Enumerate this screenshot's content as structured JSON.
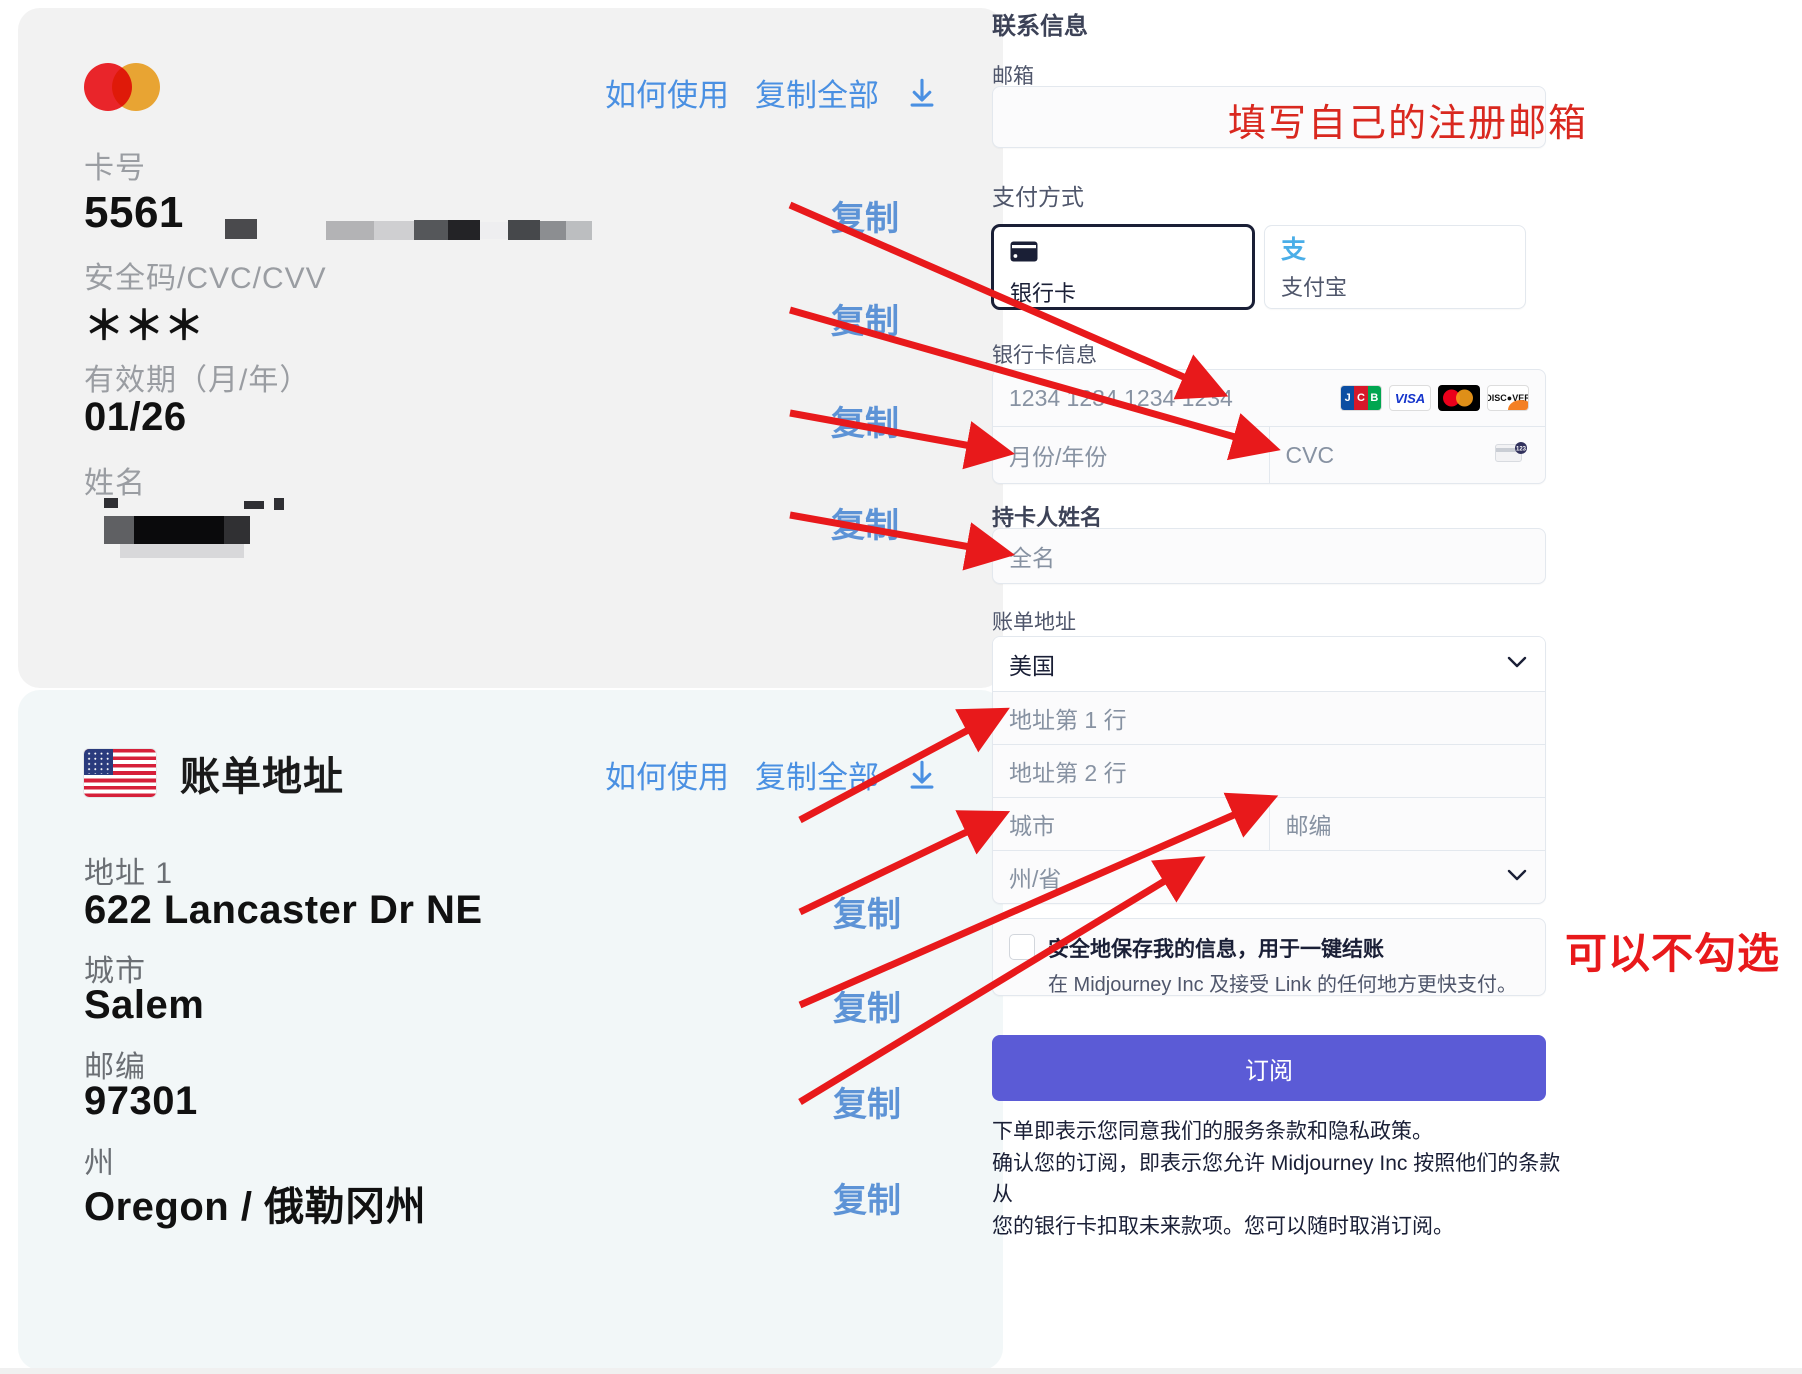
{
  "left": {
    "card_section": {
      "brand_icon": "mastercard-icon",
      "how_to_use": "如何使用",
      "copy_all": "复制全部",
      "download_icon": "download-icon",
      "fields": [
        {
          "label": "卡号",
          "value": "5561",
          "redacted": true,
          "copy": "复制"
        },
        {
          "label": "安全码/CVC/CVV",
          "value": "＊＊＊",
          "redacted": false,
          "copy": "复制"
        },
        {
          "label": "有效期（月/年）",
          "value": "01/26",
          "redacted": false,
          "copy": "复制"
        },
        {
          "label": "姓名",
          "value": "",
          "redacted": true,
          "copy": "复制"
        }
      ]
    },
    "address_section": {
      "flag_icon": "us-flag-icon",
      "title": "账单地址",
      "how_to_use": "如何使用",
      "copy_all": "复制全部",
      "download_icon": "download-icon",
      "fields": [
        {
          "label": "地址 1",
          "value": "622 Lancaster Dr NE",
          "copy": "复制"
        },
        {
          "label": "城市",
          "value": "Salem",
          "copy": "复制"
        },
        {
          "label": "邮编",
          "value": "97301",
          "copy": "复制"
        },
        {
          "label": "州",
          "value": "Oregon / 俄勒冈州",
          "copy": "复制"
        }
      ]
    }
  },
  "right": {
    "contact": {
      "heading": "联系信息",
      "email_label": "邮箱",
      "email_value": "",
      "email_placeholder": ""
    },
    "payment_method": {
      "heading": "支付方式",
      "options": [
        {
          "label": "银行卡",
          "icon": "credit-card-icon",
          "selected": true
        },
        {
          "label": "支付宝",
          "icon": "alipay-icon",
          "selected": false
        }
      ]
    },
    "card_info": {
      "heading": "银行卡信息",
      "number_placeholder": "1234 1234 1234 1234",
      "expiry_placeholder": "月份/年份",
      "cvc_placeholder": "CVC",
      "brands": [
        "JCB",
        "VISA",
        "mastercard",
        "DISCOVER"
      ]
    },
    "cardholder": {
      "heading": "持卡人姓名",
      "placeholder": "全名"
    },
    "billing": {
      "heading": "账单地址",
      "country_value": "美国",
      "line1_placeholder": "地址第 1 行",
      "line2_placeholder": "地址第 2 行",
      "city_placeholder": "城市",
      "postal_placeholder": "邮编",
      "state_placeholder": "州/省"
    },
    "save_info": {
      "title": "安全地保存我的信息，用于一键结账",
      "subtitle": "在 Midjourney Inc 及接受 Link 的任何地方更快支付。",
      "checked": false
    },
    "submit": {
      "label": "订阅"
    },
    "legal": {
      "line1": "下单即表示您同意我们的服务条款和隐私政策。",
      "line2": "确认您的订阅，即表示您允许 Midjourney Inc 按照他们的条款从",
      "line3": "您的银行卡扣取未来款项。您可以随时取消订阅。"
    }
  },
  "annotations": {
    "email_note": "填写自己的注册邮箱",
    "checkbox_note": "可以不勾选"
  },
  "colors": {
    "copy_link": "#5d93d6",
    "header_link": "#4a90e2",
    "annotation_red": "#d9281f",
    "submit_bg": "#5b5bd6",
    "card_panel_bg": "#f2f2f2",
    "address_panel_bg": "#f2f7f8"
  }
}
